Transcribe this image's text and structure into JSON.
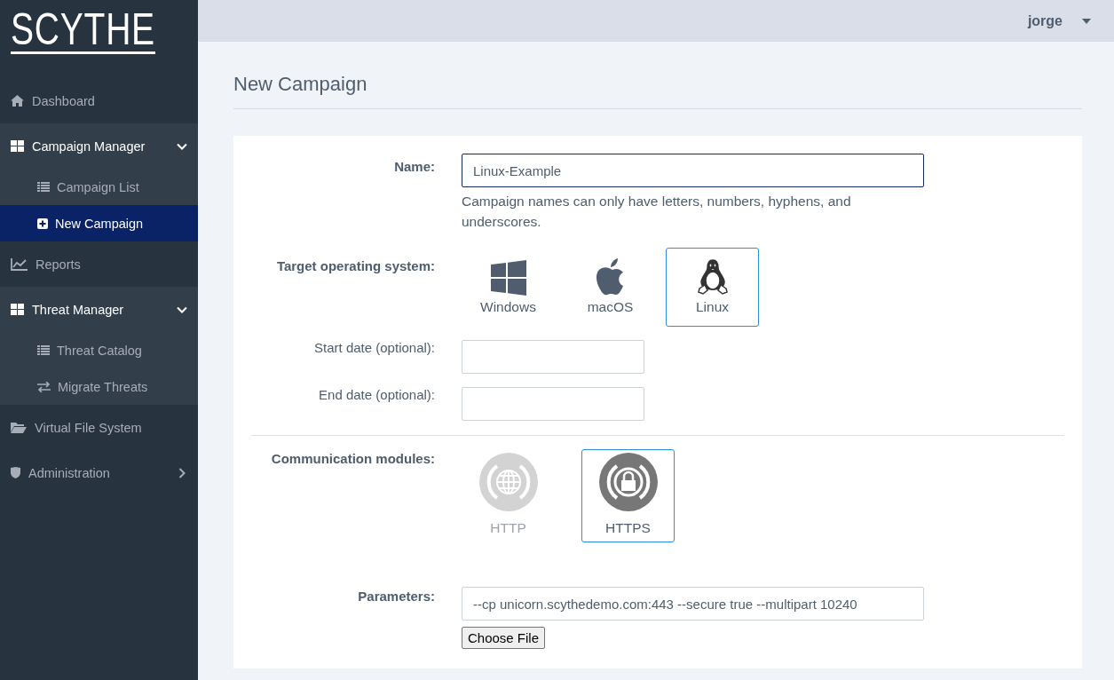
{
  "logo": "SCYTHE",
  "user_menu": {
    "username": "jorge"
  },
  "sidebar": {
    "items": [
      {
        "label": "Dashboard",
        "selected": false
      },
      {
        "label": "Campaign Manager",
        "selected": false,
        "expanded": true,
        "children": [
          {
            "label": "Campaign List",
            "selected": false
          },
          {
            "label": "New Campaign",
            "selected": true
          }
        ]
      },
      {
        "label": "Reports",
        "selected": false
      },
      {
        "label": "Threat Manager",
        "selected": false,
        "expanded": true,
        "children": [
          {
            "label": "Threat Catalog",
            "selected": false
          },
          {
            "label": "Migrate Threats",
            "selected": false
          }
        ]
      },
      {
        "label": "Virtual File System",
        "selected": false
      },
      {
        "label": "Administration",
        "selected": false,
        "expanded": false
      }
    ]
  },
  "page_title": "New Campaign",
  "form": {
    "name": {
      "label": "Name:",
      "value": "Linux-Example",
      "hint": "Campaign names can only have letters, numbers, hyphens, and underscores."
    },
    "target_os": {
      "label": "Target operating system:",
      "options": [
        {
          "label": "Windows",
          "selected": false
        },
        {
          "label": "macOS",
          "selected": false
        },
        {
          "label": "Linux",
          "selected": true
        }
      ]
    },
    "start_date": {
      "label": "Start date (optional):"
    },
    "end_date": {
      "label": "End date (optional):"
    },
    "communication_modules": {
      "label": "Communication modules:",
      "options": [
        {
          "label": "HTTP",
          "selected": false,
          "disabled": true
        },
        {
          "label": "HTTPS",
          "selected": true,
          "disabled": false
        }
      ]
    },
    "parameters": {
      "label": "Parameters:",
      "value": "--cp unicorn.scythedemo.com:443 --secure true --multipart 10240"
    },
    "file_button": "Choose File"
  }
}
